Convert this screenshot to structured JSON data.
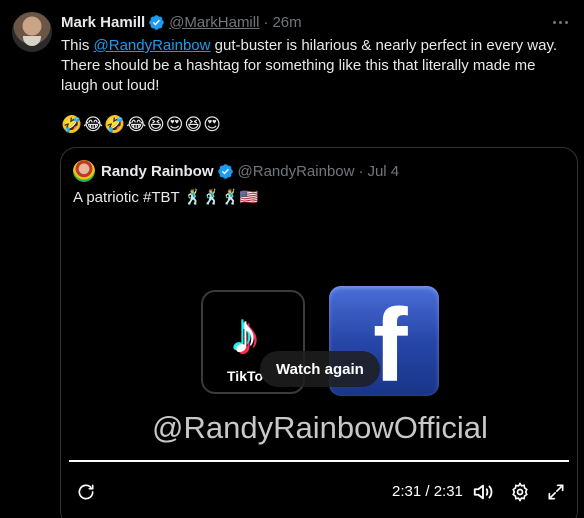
{
  "tweet": {
    "display_name": "Mark Hamill",
    "handle": "@MarkHamill",
    "separator": "·",
    "time": "26m",
    "text_before": "This ",
    "mention": "@RandyRainbow",
    "text_after": "  gut-buster is hilarious & nearly perfect in every way. There should be a hashtag for something like this that literally made me laugh out loud!",
    "emojis": "🤣😂🤣😂😆😍😆😍"
  },
  "quote": {
    "display_name": "Randy Rainbow",
    "handle": "@RandyRainbow",
    "separator": "·",
    "time": "Jul 4",
    "text": "A patriotic #TBT 🕺🕺🕺🇺🇸"
  },
  "video": {
    "tiktok_label": "TikTo",
    "tiktok_note": "♪",
    "facebook_letter": "f",
    "watch_again_label": "Watch again",
    "overlay_text": "@RandyRainbowOfficial",
    "time_readout": "2:31 / 2:31",
    "progress": 1.0
  },
  "icons": {
    "verified": "verified-badge-icon",
    "more": "more-options-icon",
    "replay": "replay-icon",
    "volume": "volume-icon",
    "settings": "settings-gear-icon",
    "fullscreen": "fullscreen-icon"
  },
  "colors": {
    "background": "#000000",
    "link": "#1d9bf0",
    "secondary_text": "#71767b",
    "verified": "#1d9bf0"
  }
}
